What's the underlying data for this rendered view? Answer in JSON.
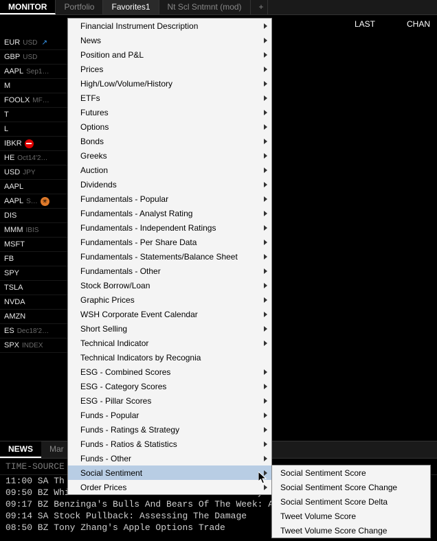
{
  "tabs": {
    "monitor": "MONITOR",
    "items": [
      "Portfolio",
      "Favorites1",
      "Nt Scl Sntmnt (mod)"
    ],
    "add": "+"
  },
  "columns": {
    "last": "LAST",
    "change": "CHAN"
  },
  "instruments": [
    {
      "sym": "EUR",
      "suffix": "USD",
      "icon": "arrow-up"
    },
    {
      "sym": "GBP",
      "suffix": "USD"
    },
    {
      "sym": "AAPL",
      "suffix": "Sep1…"
    },
    {
      "sym": "M",
      "suffix": ""
    },
    {
      "sym": "FOOLX",
      "suffix": "MF…"
    },
    {
      "sym": "T",
      "suffix": ""
    },
    {
      "sym": "L",
      "suffix": ""
    },
    {
      "sym": "IBKR",
      "suffix": "",
      "icon": "noentry"
    },
    {
      "sym": "HE",
      "suffix": "Oct14'2…"
    },
    {
      "sym": "USD",
      "suffix": "JPY"
    },
    {
      "sym": "AAPL",
      "suffix": ""
    },
    {
      "sym": "AAPL",
      "suffix": "S…",
      "icon": "orange"
    },
    {
      "sym": "DIS",
      "suffix": ""
    },
    {
      "sym": "MMM",
      "suffix": "IBIS"
    },
    {
      "sym": "MSFT",
      "suffix": ""
    },
    {
      "sym": "FB",
      "suffix": ""
    },
    {
      "sym": "SPY",
      "suffix": ""
    },
    {
      "sym": "TSLA",
      "suffix": ""
    },
    {
      "sym": "NVDA",
      "suffix": ""
    },
    {
      "sym": "AMZN",
      "suffix": ""
    },
    {
      "sym": "ES",
      "suffix": "Dec18'2…"
    },
    {
      "sym": "SPX",
      "suffix": "INDEX"
    }
  ],
  "menu": [
    {
      "label": "Financial Instrument Description",
      "sub": true
    },
    {
      "label": "News",
      "sub": true
    },
    {
      "label": "Position and P&L",
      "sub": true
    },
    {
      "label": "Prices",
      "sub": true
    },
    {
      "label": "High/Low/Volume/History",
      "sub": true
    },
    {
      "label": "ETFs",
      "sub": true
    },
    {
      "label": "Futures",
      "sub": true
    },
    {
      "label": "Options",
      "sub": true
    },
    {
      "label": "Bonds",
      "sub": true
    },
    {
      "label": "Greeks",
      "sub": true
    },
    {
      "label": "Auction",
      "sub": true
    },
    {
      "label": "Dividends",
      "sub": true
    },
    {
      "label": "Fundamentals - Popular",
      "sub": true
    },
    {
      "label": "Fundamentals - Analyst Rating",
      "sub": true
    },
    {
      "label": "Fundamentals - Independent Ratings",
      "sub": true
    },
    {
      "label": "Fundamentals - Per Share Data",
      "sub": true
    },
    {
      "label": "Fundamentals - Statements/Balance Sheet",
      "sub": true
    },
    {
      "label": "Fundamentals - Other",
      "sub": true
    },
    {
      "label": "Stock Borrow/Loan",
      "sub": true
    },
    {
      "label": "Graphic Prices",
      "sub": true
    },
    {
      "label": "WSH Corporate Event Calendar",
      "sub": true
    },
    {
      "label": "Short Selling",
      "sub": true
    },
    {
      "label": "Technical Indicator",
      "sub": true
    },
    {
      "label": "Technical Indicators by Recognia",
      "sub": false
    },
    {
      "label": "ESG - Combined Scores",
      "sub": true
    },
    {
      "label": "ESG - Category Scores",
      "sub": true
    },
    {
      "label": "ESG - Pillar Scores",
      "sub": true
    },
    {
      "label": "Funds - Popular",
      "sub": true
    },
    {
      "label": "Funds - Ratings & Strategy",
      "sub": true
    },
    {
      "label": "Funds - Ratios & Statistics",
      "sub": true
    },
    {
      "label": "Funds - Other",
      "sub": true
    },
    {
      "label": "Social Sentiment",
      "sub": true,
      "highlighted": true
    },
    {
      "label": "Order Prices",
      "sub": true
    }
  ],
  "submenu": [
    "Social Sentiment Score",
    "Social Sentiment Score Change",
    "Social Sentiment Score Delta",
    "Tweet Volume Score",
    "Tweet Volume Score Change"
  ],
  "news": {
    "tab_active": "NEWS",
    "tab_other": "Mar",
    "header": "TIME-SOURCE",
    "rows": [
      "11:00 SA Th",
      "09:50 BZ Which FAANG Stock Will Grow The Most By",
      "09:17 BZ Benzinga's Bulls And Bears Of The Week: A",
      "09:14 SA Stock Pullback: Assessing The Damage",
      "08:50 BZ Tony Zhang's Apple Options Trade"
    ]
  }
}
